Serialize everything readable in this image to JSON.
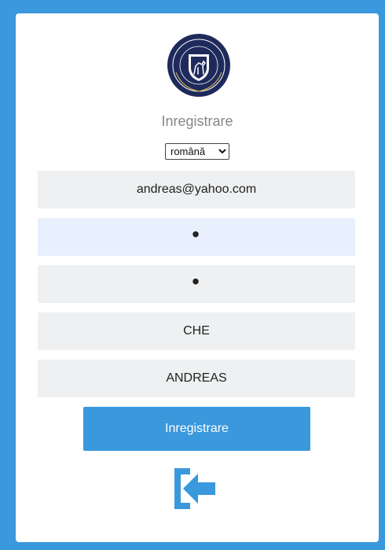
{
  "header": {
    "title": "Inregistrare"
  },
  "language": {
    "selected": "română",
    "options": [
      "română"
    ]
  },
  "form": {
    "email": "andreas@yahoo.com",
    "password": "•",
    "password_confirm": "•",
    "last_name": "CHE",
    "first_name": "ANDREAS"
  },
  "actions": {
    "submit_label": "Inregistrare",
    "back_icon": "login-arrow-icon"
  },
  "logo": {
    "name": "university-seal-logo",
    "text": "UNIVERSITATEA DE MEDICINA SI FARMACIE CAROL DAVILA"
  },
  "colors": {
    "accent": "#3a98dc",
    "field_bg": "#eef0f1",
    "field_focused_bg": "#e8f0fe",
    "logo_navy": "#1f2a5c"
  }
}
